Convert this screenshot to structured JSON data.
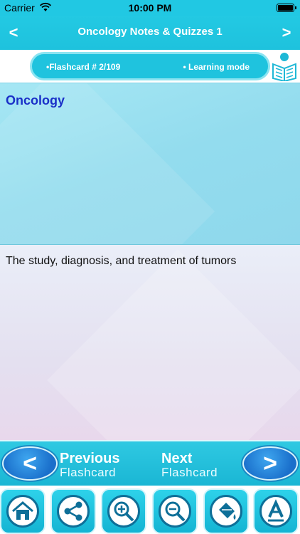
{
  "status_bar": {
    "carrier": "Carrier",
    "time": "10:00 PM"
  },
  "nav_bar": {
    "title": "Oncology Notes & Quizzes 1",
    "back_icon": "<",
    "forward_icon": ">"
  },
  "info_bar": {
    "flashcard_label": "•Flashcard #  2/109",
    "mode_label": "• Learning mode"
  },
  "card": {
    "question": "Oncology",
    "answer": "The study, diagnosis, and treatment of tumors"
  },
  "navigation": {
    "previous_line1": "Previous",
    "previous_line2": "Flashcard",
    "next_line1": "Next",
    "next_line2": "Flashcard",
    "previous_arrow": "<",
    "next_arrow": ">"
  },
  "toolbar": {
    "icons": [
      "home-icon",
      "share-icon",
      "zoom-in-icon",
      "zoom-out-icon",
      "paint-bucket-icon",
      "font-icon"
    ]
  },
  "colors": {
    "accent": "#1fc3de",
    "question_text": "#1a2fc8",
    "nav_circle": "#1a6fcb"
  }
}
